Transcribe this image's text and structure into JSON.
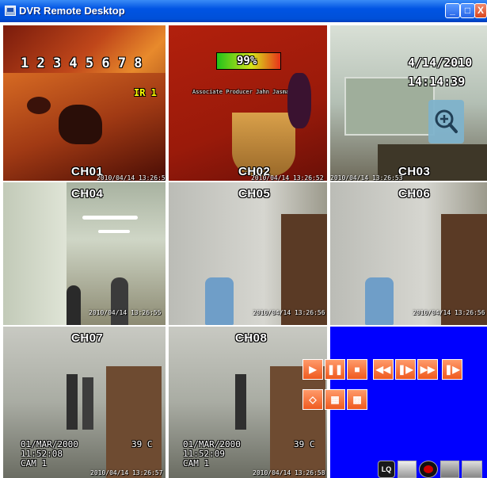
{
  "window": {
    "title": "DVR Remote Desktop"
  },
  "channels": [
    {
      "label": "CH01",
      "timestamp": "2010/04/14 13:26:5"
    },
    {
      "label": "CH02",
      "timestamp": "2010/04/14 13:26:52"
    },
    {
      "label": "CH03",
      "timestamp": "2010/04/14 13:26:53"
    },
    {
      "label": "CH04",
      "timestamp": "2010/04/14 13:26:55"
    },
    {
      "label": "CH05",
      "timestamp": "2010/04/14 13:26:56"
    },
    {
      "label": "CH06",
      "timestamp": "2010/04/14 13:26:56"
    },
    {
      "label": "CH07",
      "timestamp": "2010/04/14 13:26:57"
    },
    {
      "label": "CH08",
      "timestamp": "2010/04/14 13:26:58"
    }
  ],
  "ch01_overlay": {
    "digits": "1 2 3 4 5 6 7 8",
    "ir": "IR 1"
  },
  "ch02_overlay": {
    "level": "99%",
    "credit": "Associate Producer Jahn Jasman"
  },
  "ch03_overlay": {
    "date": "4/14/2010",
    "time": "14:14:39"
  },
  "ch07_overlay": {
    "date": "01/MAR/2000",
    "time": "11:52:08",
    "cam": "CAM 1",
    "temp": "39 C"
  },
  "ch08_overlay": {
    "date": "01/MAR/2000",
    "time": "11:52:09",
    "cam": "CAM 1",
    "temp": "39 C"
  },
  "tray": {
    "lq_label": "LQ"
  },
  "colors": {
    "control_panel_bg": "#0000ff",
    "button_orange": "#ef5a1f",
    "title_blue": "#0054e3"
  }
}
